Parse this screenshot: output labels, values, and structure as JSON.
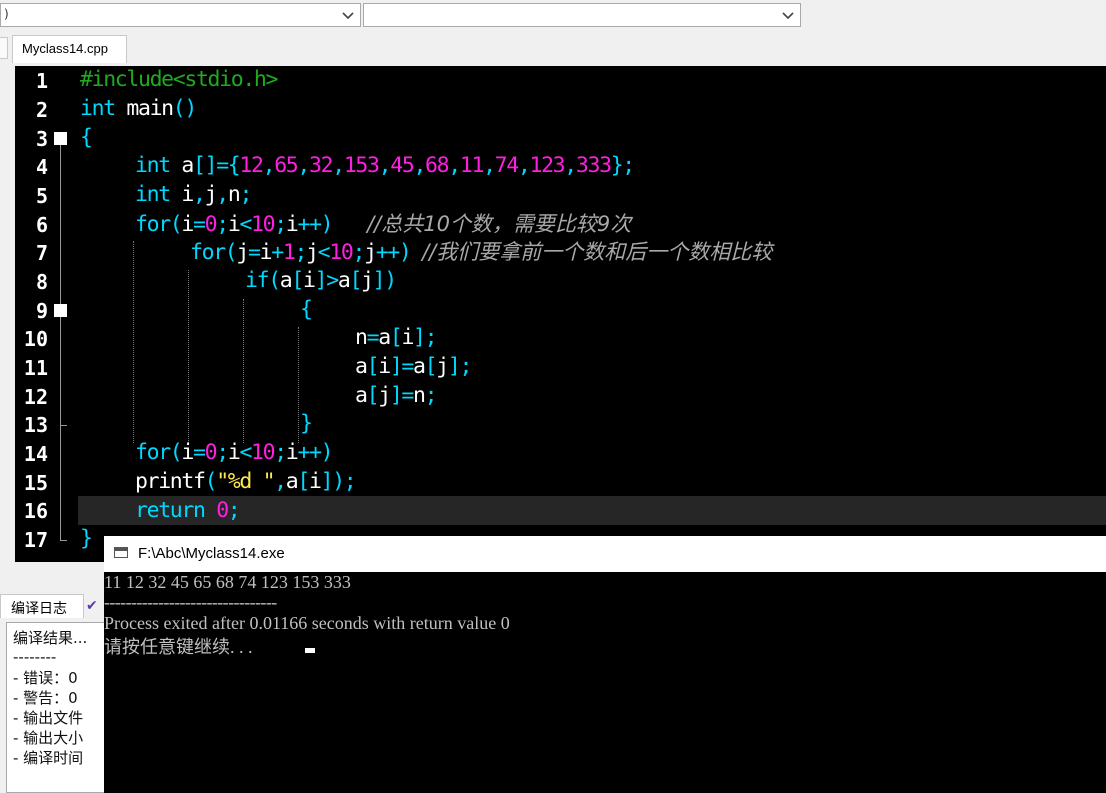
{
  "toolbar": {
    "combo1_value": ")",
    "combo2_value": ""
  },
  "tab": {
    "label": "Myclass14.cpp"
  },
  "editor": {
    "line_numbers": [
      "1",
      "2",
      "3",
      "4",
      "5",
      "6",
      "7",
      "8",
      "9",
      "10",
      "11",
      "12",
      "13",
      "14",
      "15",
      "16",
      "17"
    ],
    "current_line": "16"
  },
  "bottom_panel": {
    "tab_label": "编译日志",
    "log_lines": [
      "编译结果...",
      "--------",
      "- 错误：0",
      "- 警告：0",
      "- 输出文件",
      "- 输出大小",
      "- 编译时间"
    ]
  },
  "console": {
    "title": "F:\\Abc\\Myclass14.exe",
    "lines": [
      "11 12 32 45 65 68 74 123 153 333",
      "--------------------------------",
      "Process exited after 0.01166 seconds with return value 0",
      "请按任意键继续. . . "
    ]
  },
  "colors": {
    "editor_bg": "#000000",
    "keyword": "#00d8ff",
    "number": "#ff1fe0",
    "preprocessor": "#1faa1f",
    "string": "#ffe94d",
    "comment": "#a9a9a9"
  }
}
